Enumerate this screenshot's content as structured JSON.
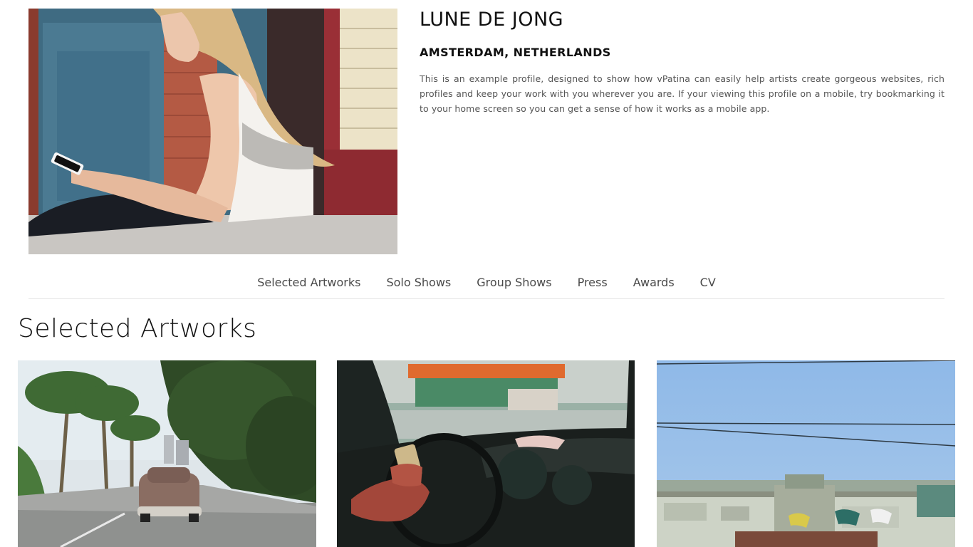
{
  "profile": {
    "name": "LUNE DE JONG",
    "location": "AMSTERDAM, NETHERLANDS",
    "bio": "This is an example profile, designed to show how vPatina can easily help artists create gorgeous websites, rich profiles and keep your work with you wherever you are. If your viewing this profile on a mobile, try bookmarking it to your home screen so you can get a sense of how it works as a mobile app."
  },
  "nav": {
    "items": [
      {
        "label": "Selected Artworks"
      },
      {
        "label": "Solo Shows"
      },
      {
        "label": "Group Shows"
      },
      {
        "label": "Press"
      },
      {
        "label": "Awards"
      },
      {
        "label": "CV"
      }
    ]
  },
  "section": {
    "title": "Selected Artworks"
  },
  "colors": {
    "text": "#111111",
    "nav_text": "#4a4a4a",
    "bio_text": "#555555",
    "divider": "#e5e5e5"
  }
}
